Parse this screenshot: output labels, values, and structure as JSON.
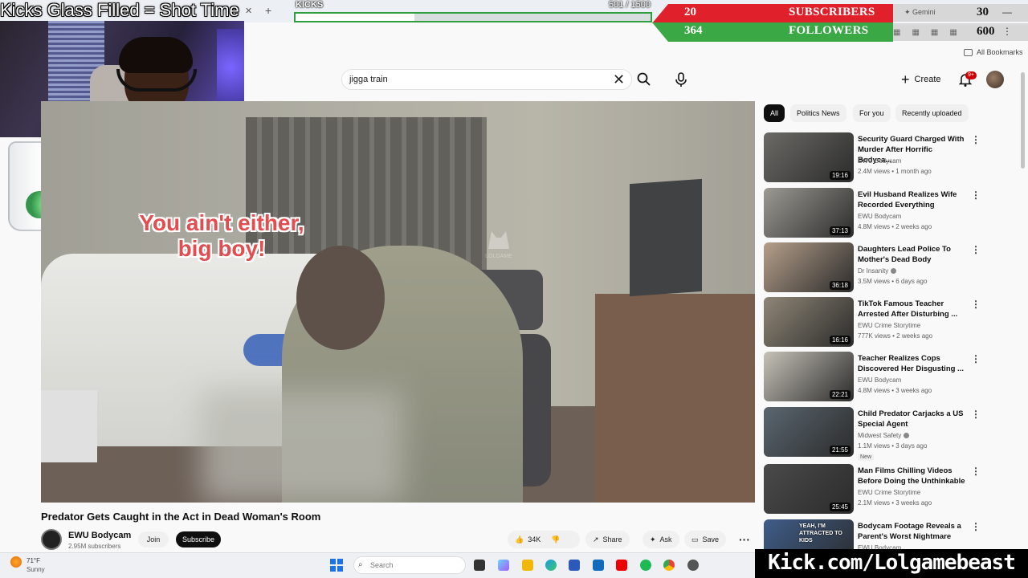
{
  "overlay": {
    "glass_title": "Kicks Glass Filled =  Shot Time",
    "glass_fill_text": "KICKS",
    "kicks": {
      "label": "KICKS",
      "count": "501  / 1500",
      "progress": 0.334
    },
    "subscribers": {
      "count": "20",
      "label": "SUBSCRIBERS",
      "goal": "30",
      "accent": "#e0212b"
    },
    "followers": {
      "count": "364",
      "label": "FOLLOWERS",
      "goal": "600",
      "accent": "#3aa845"
    },
    "gemini_label": "Gemini",
    "kick_url": "Kick.com/Lolgamebeast"
  },
  "browser": {
    "bookmarks_label": "All Bookmarks",
    "window_buttons": [
      "—",
      "☐",
      "✕"
    ]
  },
  "header": {
    "search_query": "jigga train",
    "create_label": "Create",
    "notification_badge": "9+"
  },
  "video": {
    "caption": "You ain't either, big boy!",
    "watermark": "LOLGAME",
    "title": "Predator Gets Caught in the Act in Dead Woman's Room",
    "channel": "EWU Bodycam",
    "subscribers": "2.95M subscribers",
    "join_label": "Join",
    "subscribe_label": "Subscribe",
    "likes": "34K",
    "share_label": "Share",
    "ask_label": "Ask",
    "save_label": "Save"
  },
  "chips": [
    "All",
    "Politics News",
    "For you",
    "Recently uploaded"
  ],
  "recommendations": [
    {
      "title": "Security Guard Charged With Murder After Horrific Bodyca...",
      "channel": "EWU Bodycam",
      "meta": "2.4M views • 1 month ago",
      "duration": "19:16",
      "verified": false,
      "new": false,
      "color": "#6b6a66"
    },
    {
      "title": "Evil Husband Realizes Wife Recorded Everything",
      "channel": "EWU Bodycam",
      "meta": "4.8M views • 2 weeks ago",
      "duration": "37:13",
      "verified": false,
      "new": false,
      "color": "#9c9a93"
    },
    {
      "title": "Daughters Lead Police To Mother's Dead Body",
      "channel": "Dr Insanity",
      "meta": "3.5M views • 6 days ago",
      "duration": "36:18",
      "verified": true,
      "new": false,
      "color": "#b59f8a"
    },
    {
      "title": "TikTok Famous Teacher Arrested After Disturbing ...",
      "channel": "EWU Crime Storytime",
      "meta": "777K views • 2 weeks ago",
      "duration": "16:16",
      "verified": false,
      "new": false,
      "color": "#8f8676"
    },
    {
      "title": "Teacher Realizes Cops Discovered Her Disgusting ...",
      "channel": "EWU Bodycam",
      "meta": "4.8M views • 3 weeks ago",
      "duration": "22:21",
      "verified": false,
      "new": false,
      "color": "#c6c2b8"
    },
    {
      "title": "Child Predator Carjacks a US Special Agent",
      "channel": "Midwest Safety",
      "meta": "1.1M views • 3 days ago",
      "duration": "21:55",
      "verified": true,
      "new": true,
      "new_label": "New",
      "color": "#5a6670"
    },
    {
      "title": "Man Films Chilling Videos Before Doing the Unthinkable",
      "channel": "EWU Crime Storytime",
      "meta": "2.1M views • 3 weeks ago",
      "duration": "25:45",
      "verified": false,
      "new": false,
      "color": "#4a4a4a"
    },
    {
      "title": "Bodycam Footage Reveals a Parent's Worst Nightmare",
      "channel": "EWU Bodycam",
      "meta": "",
      "duration": "",
      "verified": false,
      "new": false,
      "thumb_text": "YEAH, I'M ATTRACTED TO KIDS",
      "color": "#3f5d8a"
    }
  ],
  "taskbar": {
    "temperature": "71°F",
    "weather": "Sunny",
    "search_label": "Search"
  }
}
